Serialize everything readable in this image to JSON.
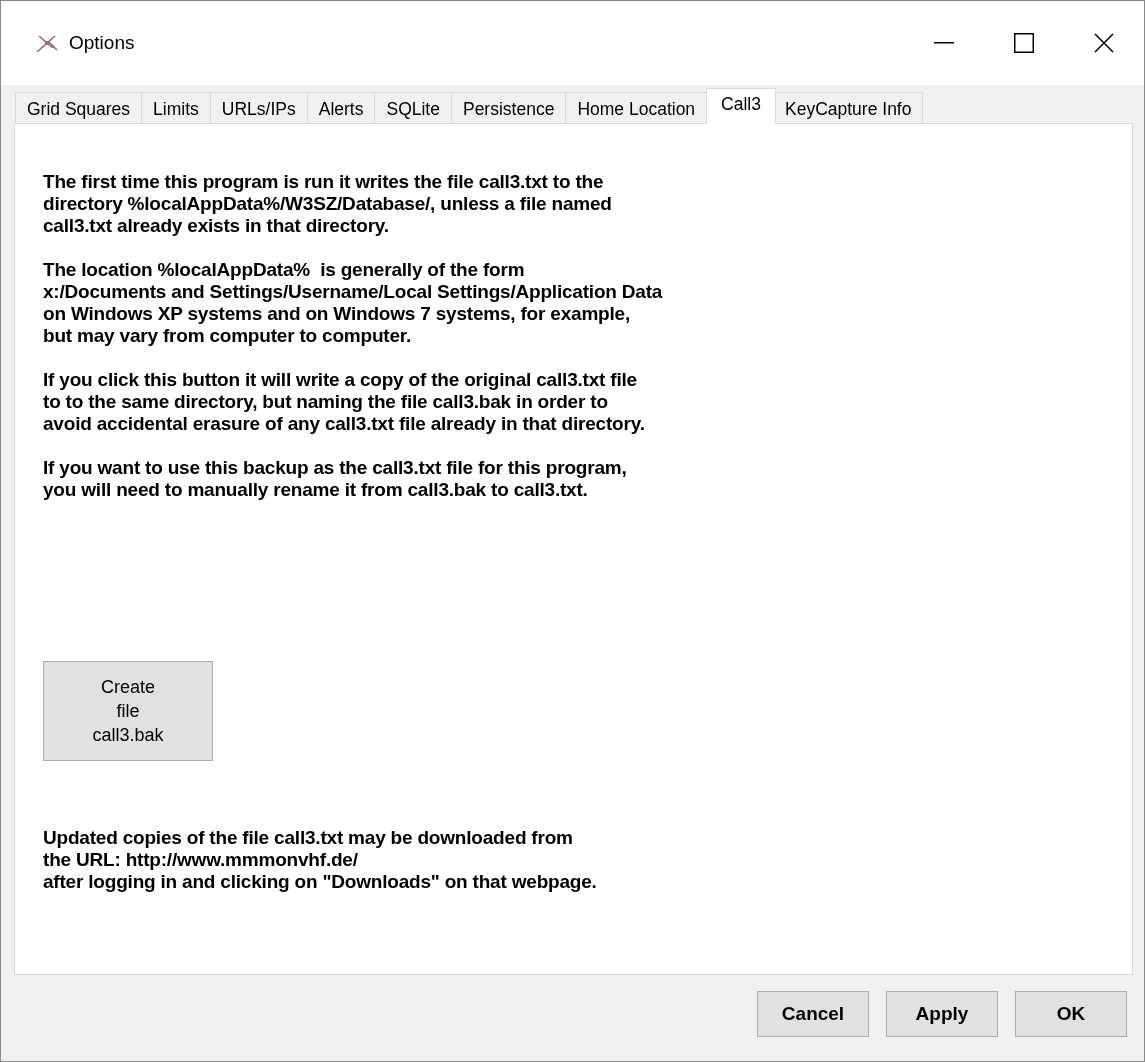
{
  "window": {
    "title": "Options"
  },
  "tabs": [
    {
      "label": "Grid Squares",
      "selected": false
    },
    {
      "label": "Limits",
      "selected": false
    },
    {
      "label": "URLs/IPs",
      "selected": false
    },
    {
      "label": "Alerts",
      "selected": false
    },
    {
      "label": "SQLite",
      "selected": false
    },
    {
      "label": "Persistence",
      "selected": false
    },
    {
      "label": "Home Location",
      "selected": false
    },
    {
      "label": "Call3",
      "selected": true
    },
    {
      "label": "KeyCapture Info",
      "selected": false
    }
  ],
  "paragraphs": [
    [
      "The first time this program is run it writes the file call3.txt to the",
      "directory %localAppData%/W3SZ/Database/, unless a file named",
      "call3.txt already exists in that directory."
    ],
    [
      "The location %localAppData%  is generally of the form",
      "x:/Documents and Settings/Username/Local Settings/Application Data",
      "on Windows XP systems and on Windows 7 systems, for example,",
      "but may vary from computer to computer."
    ],
    [
      "If you click this button it will write a copy of the original call3.txt file",
      "to to the same directory, but naming the file call3.bak in order to",
      "avoid accidental erasure of any call3.txt file already in that directory."
    ],
    [
      "If you want to use this backup as the call3.txt file for this program,",
      "you will need to manually rename it from call3.bak to call3.txt."
    ]
  ],
  "create_button": [
    "Create",
    "file",
    "call3.bak"
  ],
  "download_note": [
    "Updated copies of the file call3.txt may be downloaded from",
    "the URL: http://www.mmmonvhf.de/",
    "after logging in and clicking on \"Downloads\" on that webpage."
  ],
  "buttons": [
    "Cancel",
    "Apply",
    "OK"
  ]
}
